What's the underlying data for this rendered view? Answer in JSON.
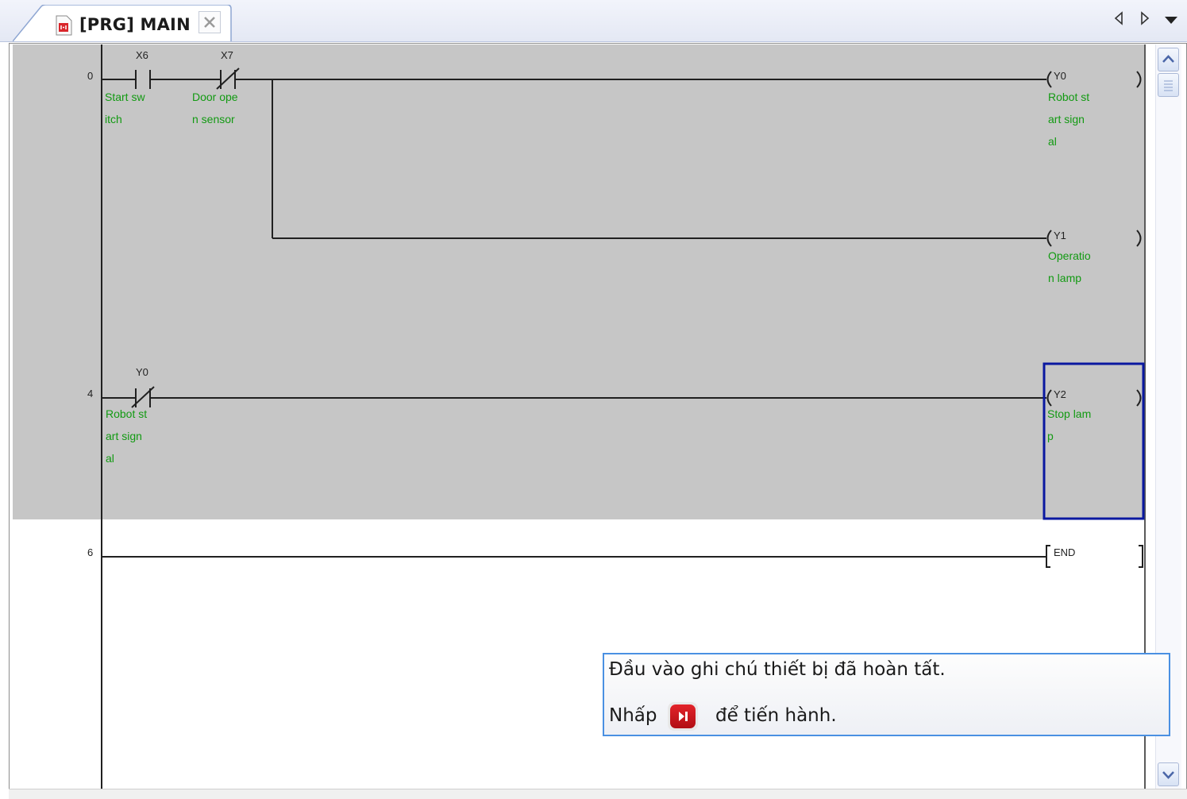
{
  "tab": {
    "title": "[PRG] MAIN"
  },
  "ladder": {
    "rungs": [
      {
        "step": "0",
        "contacts": [
          {
            "device": "X6",
            "type": "NO",
            "comment": [
              "Start sw",
              "itch"
            ]
          },
          {
            "device": "X7",
            "type": "NC",
            "comment": [
              "Door ope",
              "n sensor"
            ]
          }
        ],
        "coils": [
          {
            "device": "Y0",
            "comment": [
              "Robot st",
              "art sign",
              "al"
            ]
          },
          {
            "device": "Y1",
            "comment": [
              "Operatio",
              "n lamp"
            ]
          }
        ]
      },
      {
        "step": "4",
        "contacts": [
          {
            "device": "Y0",
            "type": "NC",
            "comment": [
              "Robot st",
              "art sign",
              "al"
            ]
          }
        ],
        "coils": [
          {
            "device": "Y2",
            "comment": [
              "Stop lam",
              "p"
            ]
          }
        ]
      },
      {
        "step": "6",
        "instruction": "END"
      }
    ]
  },
  "tooltip": {
    "line1": "Đầu vào ghi chú thiết bị đã hoàn tất.",
    "line2_before": "Nhấp",
    "line2_after": "để tiến hành."
  },
  "colors": {
    "comment": "#129a12",
    "selection": "#0a18a0",
    "edited_background": "#c6c6c6",
    "tooltip_border": "#4a90e2",
    "play_button": "#d0161c"
  },
  "icons": [
    "program-file-icon",
    "close-icon",
    "scroll-left-icon",
    "scroll-right-icon",
    "tab-list-icon",
    "scroll-up-icon",
    "scroll-down-icon",
    "play-step-icon"
  ]
}
